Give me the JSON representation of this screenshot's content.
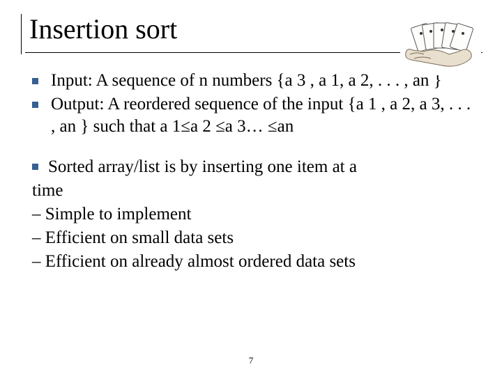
{
  "title": "Insertion sort",
  "image_alt": "hand-holding-sorted-cards",
  "bullets_top": [
    "Input: A sequence of n numbers {a 3 , a 1, a 2, . . . , an }",
    "Output: A reordered sequence of the input {a 1 , a 2, a 3, . . . , an } such that a 1≤a 2 ≤a 3… ≤an"
  ],
  "para_first": "Sorted array/list is by inserting one item at a",
  "para_lines": [
    "time",
    "– Simple to implement",
    "– Efficient on small data sets",
    "– Efficient on already almost ordered data sets"
  ],
  "page_number": "7"
}
